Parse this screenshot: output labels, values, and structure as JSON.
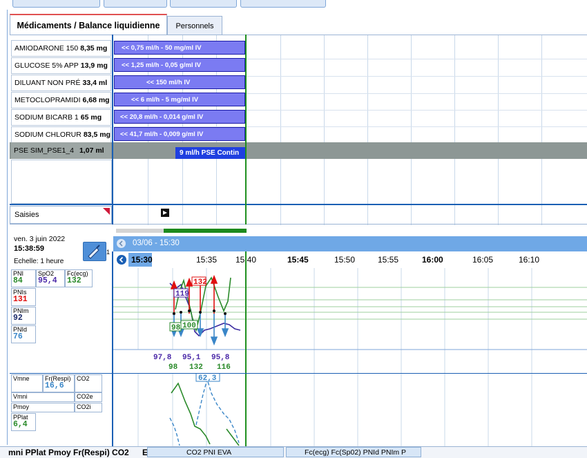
{
  "tabs": {
    "medications": "Médicaments / Balance liquidienne",
    "personnels": "Personnels"
  },
  "medications": [
    {
      "name": "AMIODARONE 150",
      "amount": "8,35 mg",
      "rate": "<< 0,75 ml/h - 50 mg/ml  IV"
    },
    {
      "name": "GLUCOSE 5% APP",
      "amount": "13,9 mg",
      "rate": "<< 1,25 ml/h - 0,05 g/ml  IV"
    },
    {
      "name": "DILUANT NON PRÉ",
      "amount": "33,4 ml",
      "rate": "<< 150 ml/h  IV"
    },
    {
      "name": "METOCLOPRAMIDI",
      "amount": "6,68 mg",
      "rate": "<< 6 ml/h - 5 mg/ml  IV"
    },
    {
      "name": "SODIUM BICARB 1",
      "amount": "65 mg",
      "rate": "<< 20,8 ml/h - 0,014 g/ml  IV"
    },
    {
      "name": "SODIUM CHLORUR",
      "amount": "83,5 mg",
      "rate": "<< 41,7 ml/h - 0,009 g/ml  IV"
    }
  ],
  "pse": {
    "name": "PSE SIM_PSE1_4",
    "amount": "1,07 ml",
    "rate": "9 ml/h  PSE Contin"
  },
  "saisies": "Saisies",
  "info": {
    "date": "ven. 3 juin 2022",
    "time": "15:38:59",
    "scale": "Echelle: 1 heure",
    "pen_count": "1"
  },
  "timeline": {
    "header": "03/06 - 15:30",
    "ticks": [
      "15:30",
      "15:35",
      "15:40",
      "15:45",
      "15:50",
      "15:55",
      "16:00",
      "16:05",
      "16:10"
    ],
    "bold_ticks": [
      "15:30",
      "15:45",
      "16:00"
    ]
  },
  "params": {
    "pni": {
      "label": "PNI",
      "value": "84"
    },
    "spo2": {
      "label": "SpO2",
      "value": "95,4"
    },
    "fc": {
      "label": "Fc(ecg)",
      "value": "132"
    },
    "pnis": {
      "label": "PNIs",
      "value": "131"
    },
    "pnim": {
      "label": "PNIm",
      "value": "92"
    },
    "pnid": {
      "label": "PNId",
      "value": "76"
    },
    "vmne": {
      "label": "Vmne"
    },
    "frrespi": {
      "label": "Fr(Respi)",
      "value": "16,6"
    },
    "co2": {
      "label": "CO2"
    },
    "vmni": {
      "label": "Vmni"
    },
    "co2e": {
      "label": "CO2e"
    },
    "pmoy": {
      "label": "Pmoy"
    },
    "co2i": {
      "label": "CO2i"
    },
    "pplat": {
      "label": "PPlat",
      "value": "6,4"
    }
  },
  "chart_annotations": {
    "pnis_top": "132",
    "pni_a": "119",
    "pnid_a": "98",
    "pnim_a": "100",
    "co2_peak": "62,3"
  },
  "summary_values": {
    "spo2_row": [
      "97,8",
      "95,1",
      "95,8"
    ],
    "fc_row": [
      "98",
      "132",
      "116"
    ]
  },
  "bottom": {
    "left_text": "mni PPlat Pmoy Fr(Respi) CO2",
    "left_trail": "E",
    "tab1": "CO2   PNI   EVA",
    "tab2": "Fc(ecg) Fc(Sp02) PNId PNIm P"
  },
  "colors": {
    "bar_fill": "#7b7bf2",
    "pse_fill": "#1f3fe0",
    "timeline_blue": "#6fa8e6",
    "now_green": "#1f8f1f",
    "pni_red": "#e01010",
    "spo2_purple": "#4b2aa8",
    "fc_green": "#2a8a2a",
    "pnid_blue": "#3a86c8"
  }
}
